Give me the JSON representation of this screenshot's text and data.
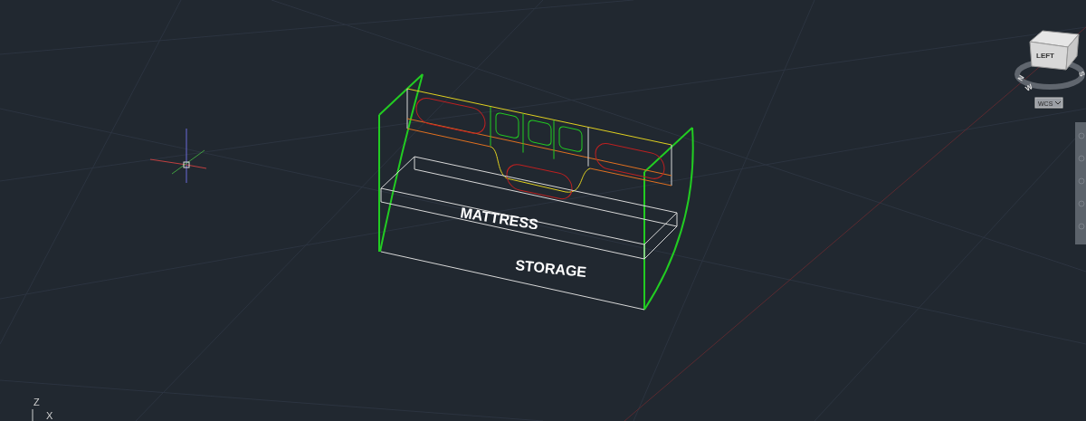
{
  "drawing_labels": [
    {
      "kind": "mattress",
      "text": "MATTRESS"
    },
    {
      "kind": "storage",
      "text": "STORAGE"
    }
  ],
  "view_cube": {
    "face": "LEFT",
    "compass": [
      "N",
      "W",
      "S"
    ],
    "ucs_menu": "WCS"
  },
  "ucs_icon": {
    "axes": [
      "Z",
      "X"
    ]
  }
}
